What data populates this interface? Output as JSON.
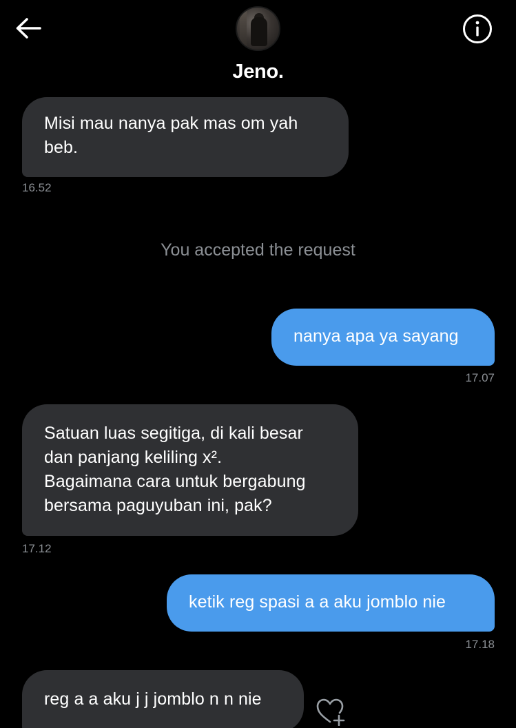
{
  "header": {
    "back_icon": "arrow-left-icon",
    "contact_name": "Jeno.",
    "info_icon": "info-circle-icon"
  },
  "messages": [
    {
      "direction": "incoming",
      "text_lines": [
        "Misi mau nanya pak mas om yah",
        "beb."
      ],
      "time": "16.52"
    },
    {
      "direction": "outgoing",
      "text": "nanya apa ya sayang",
      "time": "17.07"
    },
    {
      "direction": "incoming",
      "text_lines": [
        "Satuan luas segitiga, di kali besar",
        "dan panjang keliling x².",
        "Bagaimana cara untuk bergabung",
        "bersama paguyuban ini, pak?"
      ],
      "time": "17.12"
    },
    {
      "direction": "outgoing",
      "text": "ketik reg spasi a a aku jomblo nie",
      "time": "17.18"
    },
    {
      "direction": "incoming",
      "text": "reg a a aku j j jomblo n n nie"
    }
  ],
  "system_message": "You accepted the request",
  "reaction_icon": "heart-plus-icon",
  "colors": {
    "background": "#000000",
    "incoming_bubble": "#2f3033",
    "outgoing_bubble": "#4a9bec",
    "timestamp": "#8b8f94"
  }
}
